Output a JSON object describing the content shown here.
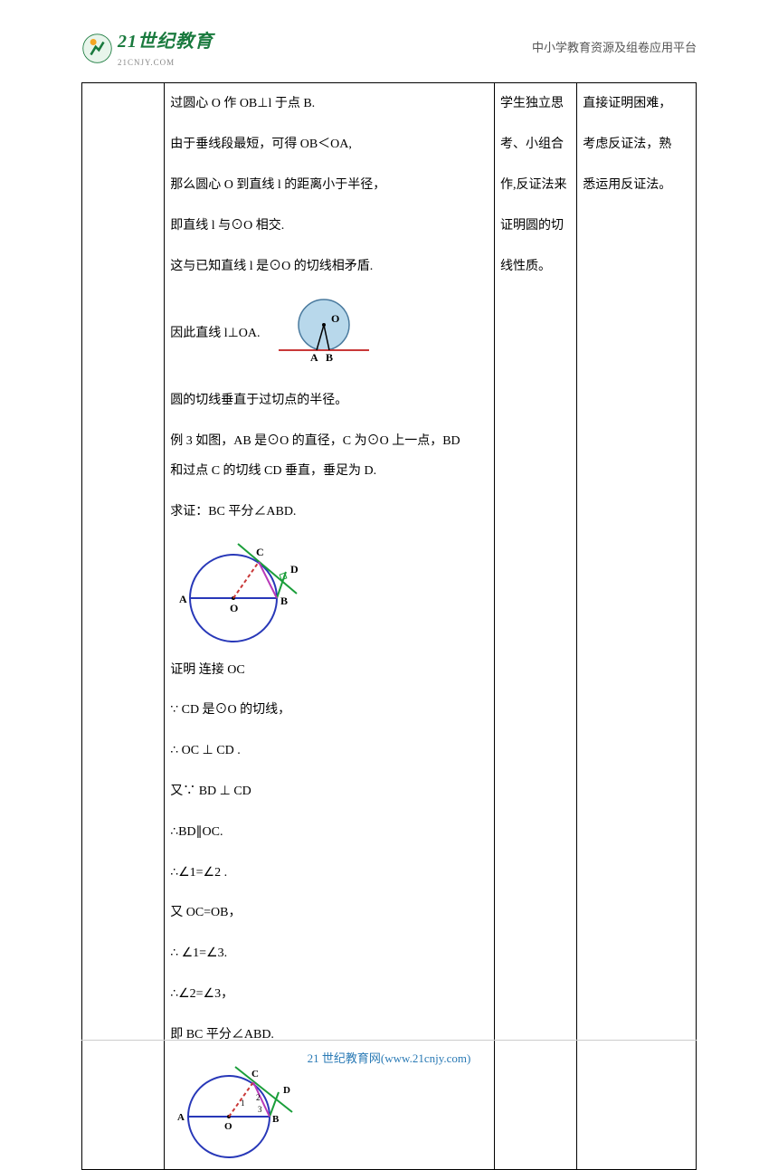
{
  "header": {
    "logo_main": "21世纪教育",
    "logo_sub": "21CNJY.COM",
    "right_text": "中小学教育资源及组卷应用平台"
  },
  "col2_lines": {
    "l1": "过圆心 O 作 OB⊥l 于点 B.",
    "l2": "由于垂线段最短，可得 OB＜OA,",
    "l3": "那么圆心 O 到直线 l 的距离小于半径，",
    "l4": "即直线 l 与⊙O 相交.",
    "l5": "这与已知直线 l 是⊙O 的切线相矛盾.",
    "l6": "因此直线 l⊥OA.",
    "l7": "圆的切线垂直于过切点的半径。",
    "l8": "例 3 如图，AB 是⊙O 的直径，C 为⊙O 上一点，BD",
    "l9": "和过点 C 的切线 CD 垂直，垂足为 D.",
    "l10": "求证：BC 平分∠ABD.",
    "l11": "证明 连接 OC",
    "l12": "∵ CD 是⊙O 的切线，",
    "l13": "∴ OC ⊥ CD .",
    "l14": " 又∵ BD ⊥ CD",
    "l15": "∴BD∥OC.",
    "l16": "∴∠1=∠2 .",
    "l17": " 又 OC=OB，",
    "l18": "∴ ∠1=∠3.",
    "l19": "∴∠2=∠3，",
    "l20": "即 BC 平分∠ABD."
  },
  "col3_lines": {
    "l1": "学生独立思",
    "l2": "考、小组合",
    "l3": "作,反证法来",
    "l4": "证明圆的切",
    "l5": "线性质。"
  },
  "col4_lines": {
    "l1": "直接证明困难，",
    "l2": "考虑反证法，熟",
    "l3": "悉运用反证法。"
  },
  "footer": "21 世纪教育网(www.21cnjy.com)",
  "diagram1_labels": {
    "O": "O",
    "A": "A",
    "B": "B"
  },
  "diagram2_labels": {
    "A": "A",
    "B": "B",
    "C": "C",
    "D": "D",
    "O": "O"
  },
  "diagram3_labels": {
    "A": "A",
    "B": "B",
    "C": "C",
    "D": "D",
    "O": "O",
    "n1": "1",
    "n2": "2",
    "n3": "3"
  }
}
